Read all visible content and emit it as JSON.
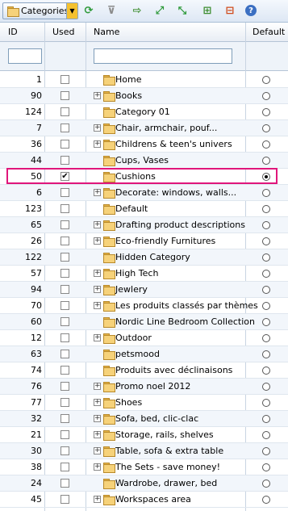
{
  "toolbar": {
    "category_button_label": "Categories",
    "icons": [
      "refresh-icon",
      "filter-icon",
      "export-icon",
      "expand-all-icon",
      "collapse-all-icon",
      "add-category-icon",
      "delete-category-icon",
      "help-icon"
    ]
  },
  "columns": {
    "id": "ID",
    "used": "Used",
    "name": "Name",
    "default": "Default"
  },
  "filters": {
    "id_value": "",
    "name_value": ""
  },
  "rows": [
    {
      "id": "1",
      "used": false,
      "expandable": false,
      "name": "Home",
      "default": false
    },
    {
      "id": "90",
      "used": false,
      "expandable": true,
      "name": "Books",
      "default": false
    },
    {
      "id": "124",
      "used": false,
      "expandable": false,
      "name": "Category 01",
      "default": false
    },
    {
      "id": "7",
      "used": false,
      "expandable": true,
      "name": "Chair, armchair, pouf...",
      "default": false
    },
    {
      "id": "36",
      "used": false,
      "expandable": true,
      "name": "Childrens & teen's univers",
      "default": false
    },
    {
      "id": "44",
      "used": false,
      "expandable": false,
      "name": "Cups, Vases",
      "default": false
    },
    {
      "id": "50",
      "used": true,
      "expandable": false,
      "name": "Cushions",
      "default": true
    },
    {
      "id": "6",
      "used": false,
      "expandable": true,
      "name": "Decorate: windows, walls...",
      "default": false
    },
    {
      "id": "123",
      "used": false,
      "expandable": false,
      "name": "Default",
      "default": false
    },
    {
      "id": "65",
      "used": false,
      "expandable": true,
      "name": "Drafting product descriptions",
      "default": false
    },
    {
      "id": "26",
      "used": false,
      "expandable": true,
      "name": "Eco-friendly Furnitures",
      "default": false
    },
    {
      "id": "122",
      "used": false,
      "expandable": false,
      "name": "Hidden Category",
      "default": false
    },
    {
      "id": "57",
      "used": false,
      "expandable": true,
      "name": "High Tech",
      "default": false
    },
    {
      "id": "94",
      "used": false,
      "expandable": true,
      "name": "Jewlery",
      "default": false
    },
    {
      "id": "70",
      "used": false,
      "expandable": true,
      "name": "Les produits classés par thèmes",
      "default": false
    },
    {
      "id": "60",
      "used": false,
      "expandable": false,
      "name": "Nordic Line Bedroom Collection",
      "default": false
    },
    {
      "id": "12",
      "used": false,
      "expandable": true,
      "name": "Outdoor",
      "default": false
    },
    {
      "id": "63",
      "used": false,
      "expandable": false,
      "name": "petsmood",
      "default": false
    },
    {
      "id": "74",
      "used": false,
      "expandable": false,
      "name": "Produits avec déclinaisons",
      "default": false
    },
    {
      "id": "76",
      "used": false,
      "expandable": true,
      "name": "Promo noel 2012",
      "default": false
    },
    {
      "id": "77",
      "used": false,
      "expandable": true,
      "name": "Shoes",
      "default": false
    },
    {
      "id": "32",
      "used": false,
      "expandable": true,
      "name": "Sofa, bed, clic-clac",
      "default": false
    },
    {
      "id": "21",
      "used": false,
      "expandable": true,
      "name": "Storage, rails, shelves",
      "default": false
    },
    {
      "id": "30",
      "used": false,
      "expandable": true,
      "name": "Table, sofa & extra table",
      "default": false
    },
    {
      "id": "38",
      "used": false,
      "expandable": true,
      "name": "The Sets - save money!",
      "default": false
    },
    {
      "id": "24",
      "used": false,
      "expandable": false,
      "name": "Wardrobe, drawer, bed",
      "default": false
    },
    {
      "id": "45",
      "used": false,
      "expandable": true,
      "name": "Workspaces area",
      "default": false
    }
  ]
}
